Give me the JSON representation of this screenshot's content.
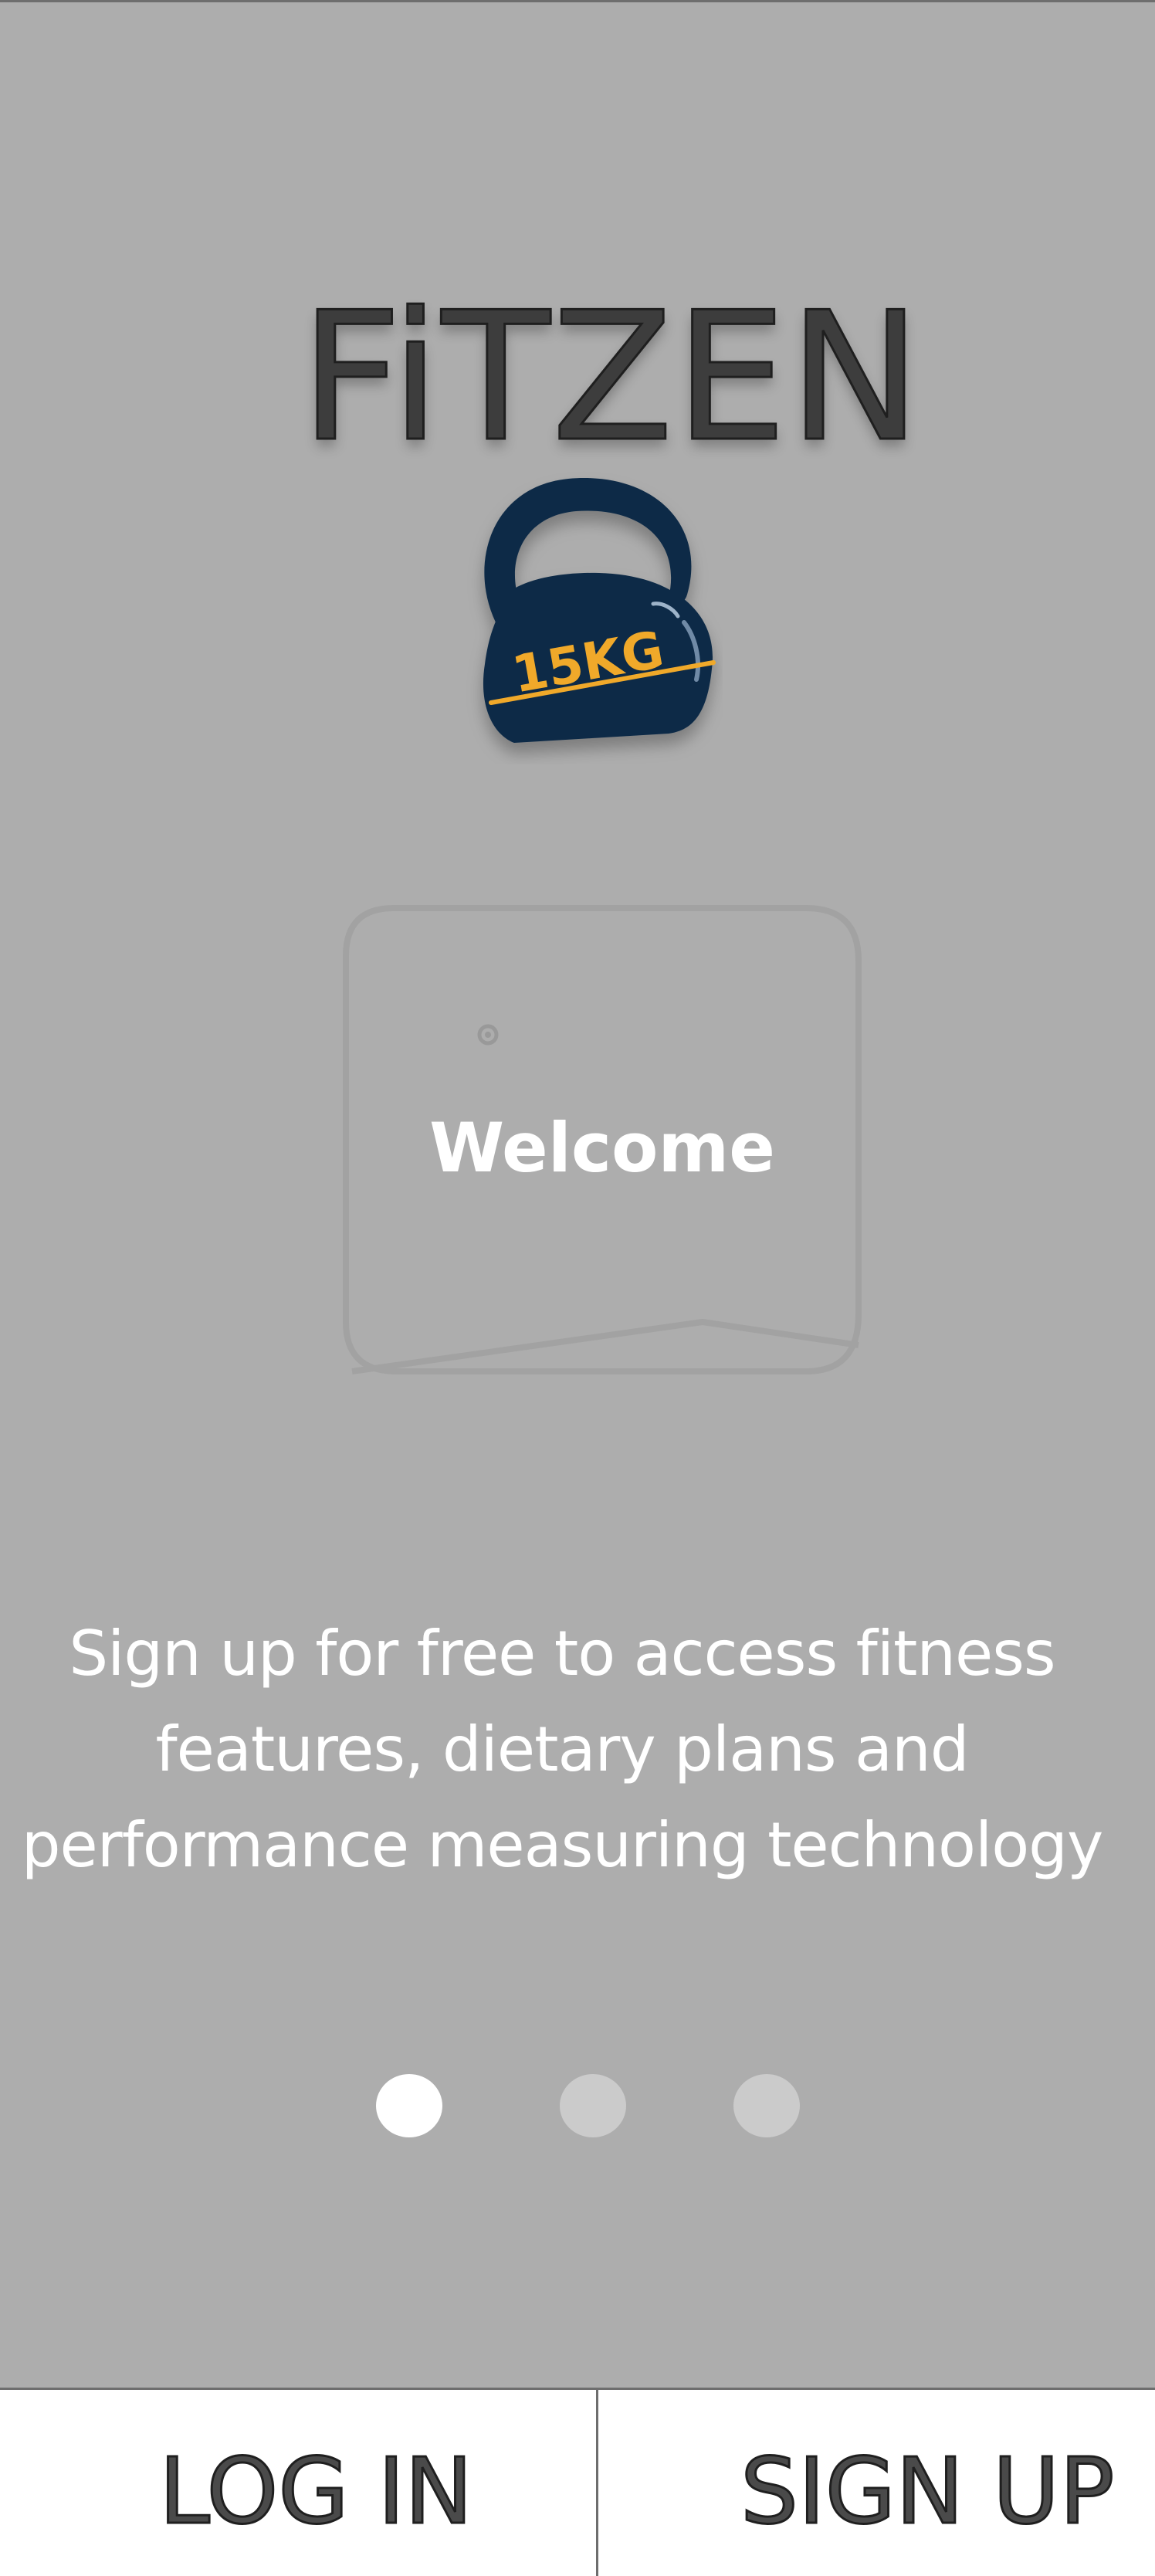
{
  "app": {
    "title": "FiTZEN",
    "logo_icon": "kettlebell-icon",
    "logo_weight_label": "15KG"
  },
  "welcome_card": {
    "title": "Welcome",
    "icon": "chat-bubble-icon"
  },
  "description": {
    "line1": "Sign up for free to access fitness",
    "line2": "features, dietary plans and",
    "line3": "performance measuring technology"
  },
  "pager": {
    "total": 3,
    "active_index": 0
  },
  "actions": {
    "login_label": "LOG IN",
    "signup_label": "SIGN UP"
  },
  "colors": {
    "background": "#adadad",
    "kettlebell": "#0f2b47",
    "kettlebell_accent": "#f0a92a",
    "dot_active": "#ffffff",
    "dot_inactive": "#cbcbcb",
    "bottom_bar": "#ffffff"
  }
}
